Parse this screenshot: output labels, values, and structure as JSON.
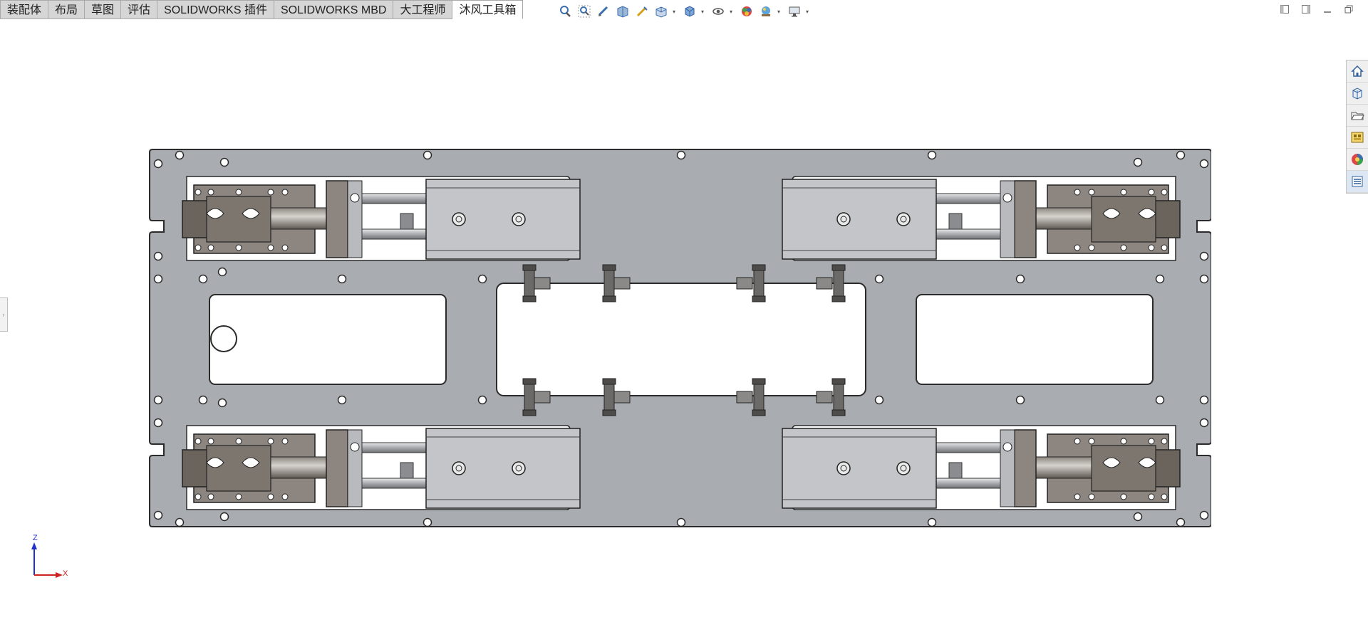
{
  "ribbon": {
    "tabs": [
      {
        "label": "装配体"
      },
      {
        "label": "布局"
      },
      {
        "label": "草图"
      },
      {
        "label": "评估"
      },
      {
        "label": "SOLIDWORKS 插件"
      },
      {
        "label": "SOLIDWORKS MBD"
      },
      {
        "label": "大工程师"
      },
      {
        "label": "沐风工具箱",
        "active": true
      }
    ]
  },
  "heads_up_toolbar": {
    "icons": [
      "zoom-to-fit-icon",
      "zoom-to-area-icon",
      "previous-view-icon",
      "section-view-icon",
      "dynamic-annotation-icon",
      "view-orientation-icon",
      "display-style-icon",
      "hide-show-items-icon",
      "edit-appearance-icon",
      "apply-scene-icon",
      "view-settings-icon"
    ]
  },
  "window_controls": {
    "icons": [
      "tile-left-icon",
      "tile-right-icon",
      "minimize-icon",
      "restore-icon"
    ]
  },
  "task_pane": {
    "icons": [
      "solidworks-resources-icon",
      "design-library-icon",
      "file-explorer-icon",
      "view-palette-icon",
      "appearances-scenes-icon",
      "custom-properties-icon"
    ]
  },
  "triad": {
    "z_label": "Z",
    "x_label": "X"
  },
  "colors": {
    "plate": "#a9acb1",
    "part_dark": "#6b645d",
    "part_mid": "#8d8680",
    "cylinder": "#c3c5c8",
    "z_axis": "#2233cc",
    "x_axis": "#cc2222"
  }
}
